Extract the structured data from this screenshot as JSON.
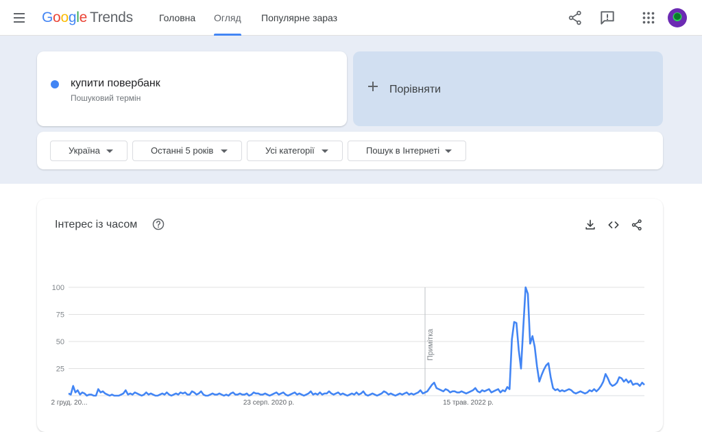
{
  "app": {
    "logo": {
      "google": [
        "G",
        "o",
        "o",
        "g",
        "l",
        "e"
      ],
      "trends": "Trends"
    },
    "icons": {
      "menu": "menu-icon",
      "share": "share-icon",
      "feedback": "feedback-icon",
      "apps": "apps-grid-icon",
      "avatar": "avatar"
    }
  },
  "nav": {
    "tabs": [
      {
        "label": "Головна"
      },
      {
        "label": "Огляд"
      },
      {
        "label": "Популярне зараз"
      }
    ],
    "active": 1
  },
  "search": {
    "term": "купити повербанк",
    "term_type": "Пошуковий термін",
    "term_color": "#4285f4",
    "compare_label": "Порівняти"
  },
  "filters": [
    {
      "label": "Україна"
    },
    {
      "label": "Останні 5 років"
    },
    {
      "label": "Усі категорії"
    },
    {
      "label": "Пошук в Інтернеті"
    }
  ],
  "chart_card": {
    "title": "Інтерес із часом",
    "annotation": "Примітка",
    "actions": [
      "download-icon",
      "embed-icon",
      "share-icon"
    ]
  },
  "chart_data": {
    "type": "line",
    "ylim": [
      0,
      100
    ],
    "y_ticks": [
      25,
      50,
      75,
      100
    ],
    "x_tick_labels": [
      "2 груд. 20...",
      "23 серп. 2020 р.",
      "15 трав. 2022 р."
    ],
    "grid": true,
    "series": [
      {
        "color": "#4285f4",
        "values": [
          2,
          1,
          9,
          3,
          5,
          1,
          3,
          2,
          0,
          1,
          1,
          0,
          0,
          6,
          3,
          4,
          2,
          1,
          0,
          1,
          0,
          0,
          0,
          1,
          2,
          5,
          1,
          2,
          1,
          3,
          2,
          1,
          0,
          1,
          3,
          1,
          2,
          1,
          0,
          0,
          1,
          2,
          1,
          3,
          1,
          0,
          1,
          2,
          1,
          3,
          2,
          3,
          1,
          1,
          4,
          3,
          1,
          2,
          4,
          1,
          0,
          0,
          1,
          2,
          1,
          1,
          2,
          1,
          0,
          1,
          0,
          2,
          3,
          1,
          1,
          2,
          1,
          1,
          2,
          0,
          1,
          3,
          2,
          2,
          1,
          1,
          2,
          1,
          0,
          1,
          2,
          3,
          1,
          2,
          3,
          1,
          0,
          1,
          2,
          3,
          1,
          2,
          1,
          0,
          1,
          2,
          4,
          1,
          2,
          1,
          3,
          1,
          2,
          2,
          4,
          2,
          1,
          2,
          3,
          1,
          2,
          1,
          0,
          1,
          2,
          1,
          3,
          1,
          2,
          4,
          1,
          0,
          1,
          2,
          1,
          0,
          1,
          2,
          4,
          3,
          1,
          2,
          1,
          0,
          1,
          2,
          1,
          2,
          3,
          1,
          2,
          1,
          2,
          3,
          5,
          2,
          3,
          4,
          7,
          10,
          12,
          7,
          6,
          5,
          4,
          6,
          5,
          3,
          4,
          4,
          3,
          3,
          4,
          3,
          2,
          3,
          4,
          5,
          7,
          4,
          3,
          5,
          4,
          5,
          6,
          3,
          4,
          5,
          6,
          3,
          5,
          4,
          8,
          6,
          52,
          68,
          67,
          42,
          25,
          63,
          100,
          94,
          48,
          55,
          45,
          27,
          13,
          19,
          24,
          28,
          30,
          17,
          7,
          5,
          6,
          4,
          5,
          4,
          5,
          6,
          5,
          3,
          2,
          3,
          4,
          3,
          2,
          3,
          5,
          4,
          6,
          4,
          6,
          9,
          13,
          20,
          16,
          11,
          9,
          10,
          12,
          17,
          16,
          13,
          15,
          12,
          14,
          10,
          11,
          11,
          9,
          12,
          10
        ]
      }
    ]
  }
}
